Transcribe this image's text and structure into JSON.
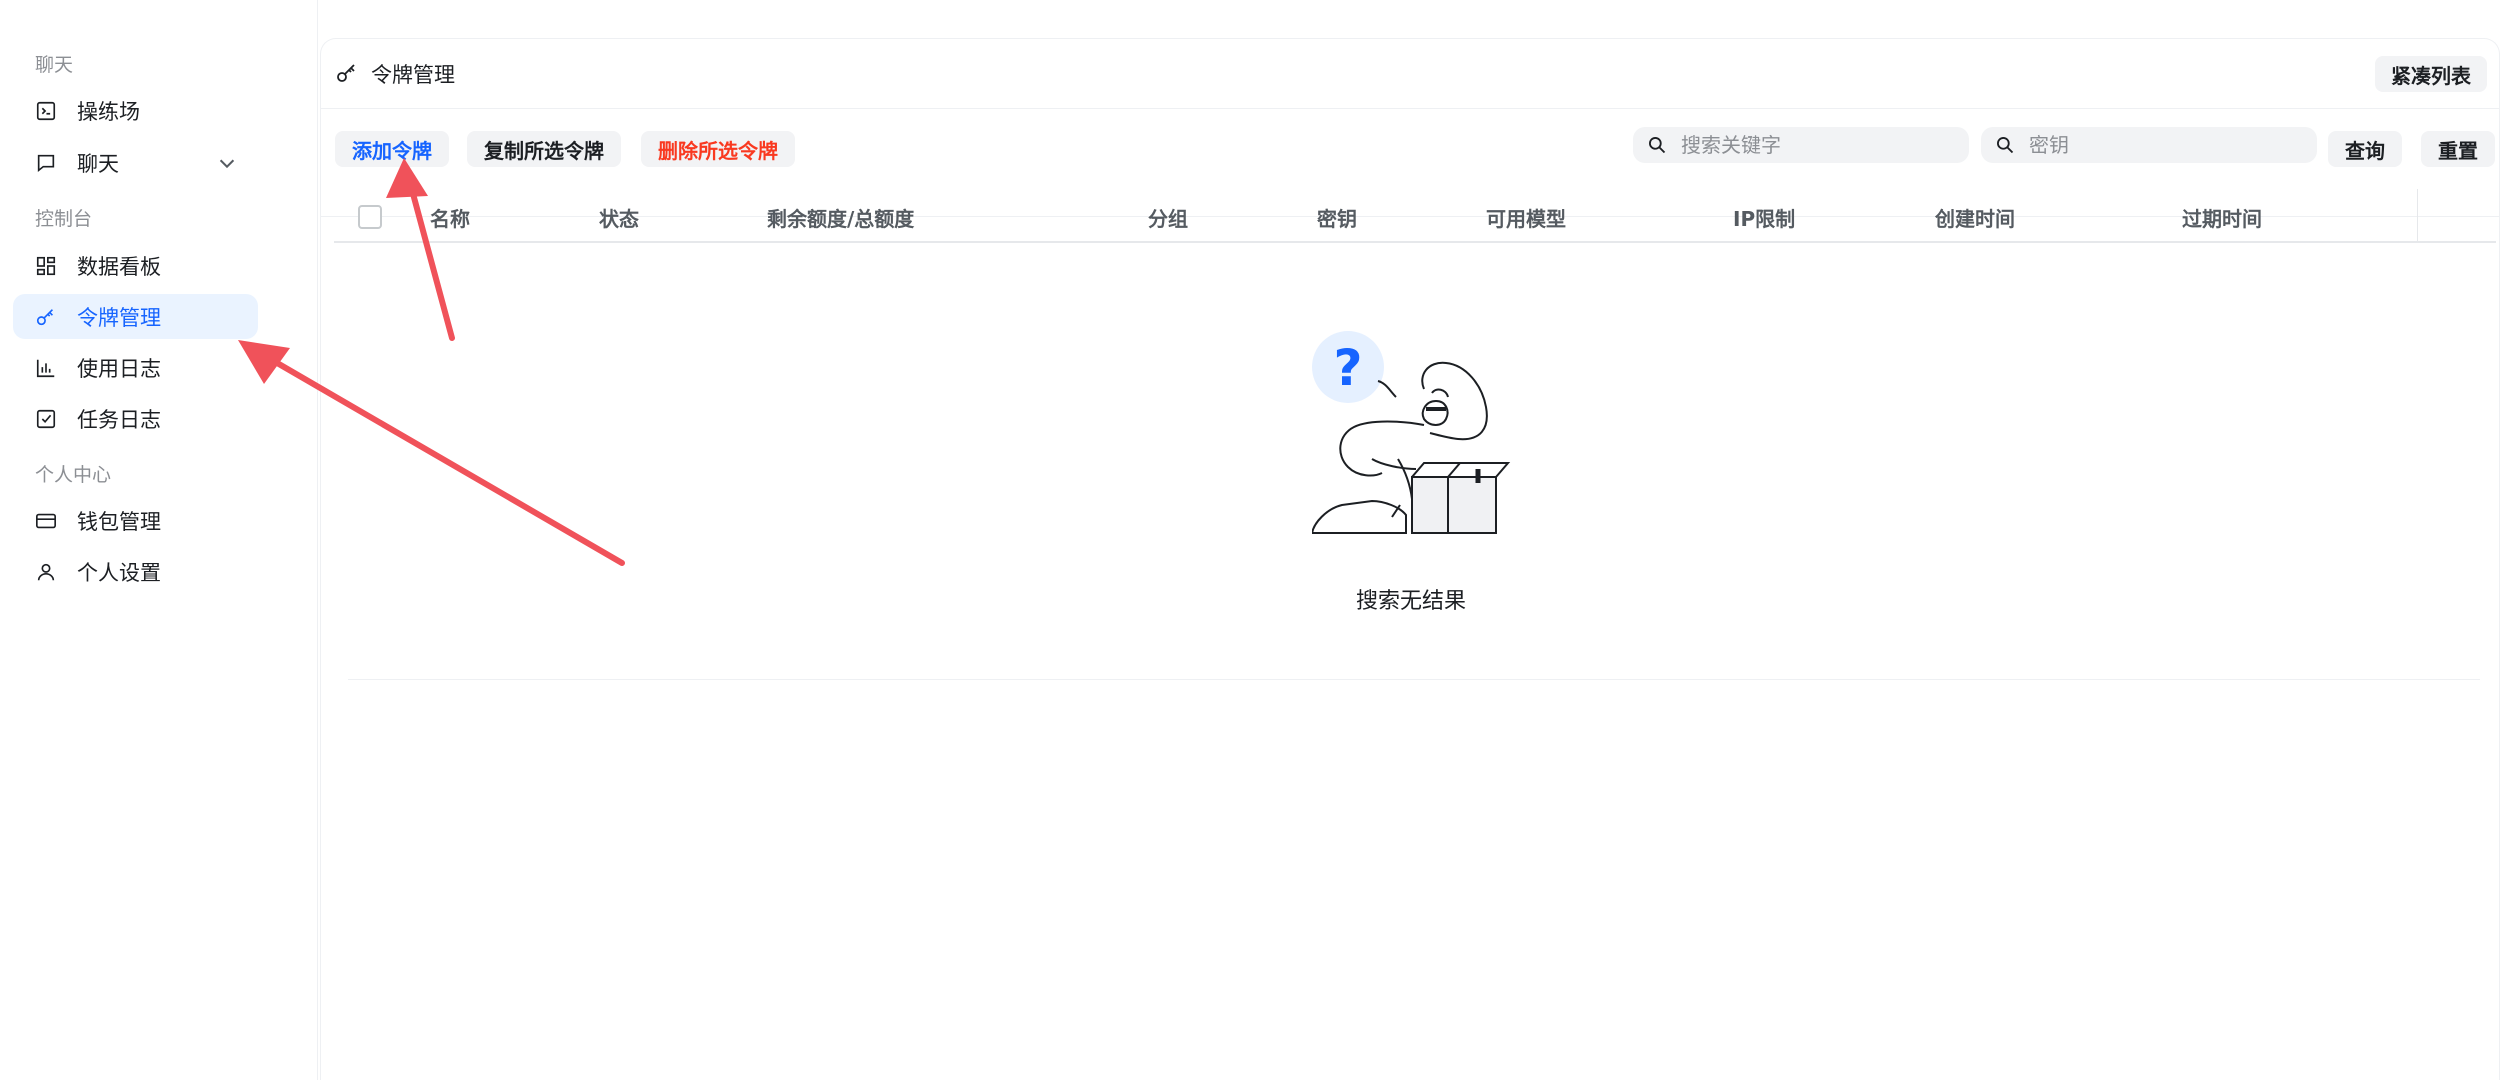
{
  "sidebar": {
    "sections": [
      {
        "label": "聊天",
        "items": [
          {
            "label": "操练场",
            "icon": "terminal-icon"
          },
          {
            "label": "聊天",
            "icon": "chat-bubble-icon",
            "has_chevron": true
          }
        ]
      },
      {
        "label": "控制台",
        "items": [
          {
            "label": "数据看板",
            "icon": "dashboard-grid-icon"
          },
          {
            "label": "令牌管理",
            "icon": "key-icon",
            "active": true
          },
          {
            "label": "使用日志",
            "icon": "bar-chart-icon"
          },
          {
            "label": "任务日志",
            "icon": "checkbox-icon"
          }
        ]
      },
      {
        "label": "个人中心",
        "items": [
          {
            "label": "钱包管理",
            "icon": "credit-card-icon"
          },
          {
            "label": "个人设置",
            "icon": "user-icon"
          }
        ]
      }
    ]
  },
  "header": {
    "title": "令牌管理",
    "title_icon": "key-icon",
    "compact_label": "紧凑列表"
  },
  "toolbar": {
    "add_label": "添加令牌",
    "copy_label": "复制所选令牌",
    "delete_label": "删除所选令牌",
    "search_placeholder": "搜索关键字",
    "key_placeholder": "密钥",
    "query_label": "查询",
    "reset_label": "重置"
  },
  "table": {
    "columns": [
      "名称",
      "状态",
      "剩余额度/总额度",
      "分组",
      "密钥",
      "可用模型",
      "IP限制",
      "创建时间",
      "过期时间"
    ],
    "rows": [],
    "empty_text": "搜索无结果"
  },
  "colors": {
    "accent": "#1664ff",
    "danger": "#f93920",
    "active_bg": "#eaf3ff",
    "annotation_arrow": "#f0525a"
  }
}
